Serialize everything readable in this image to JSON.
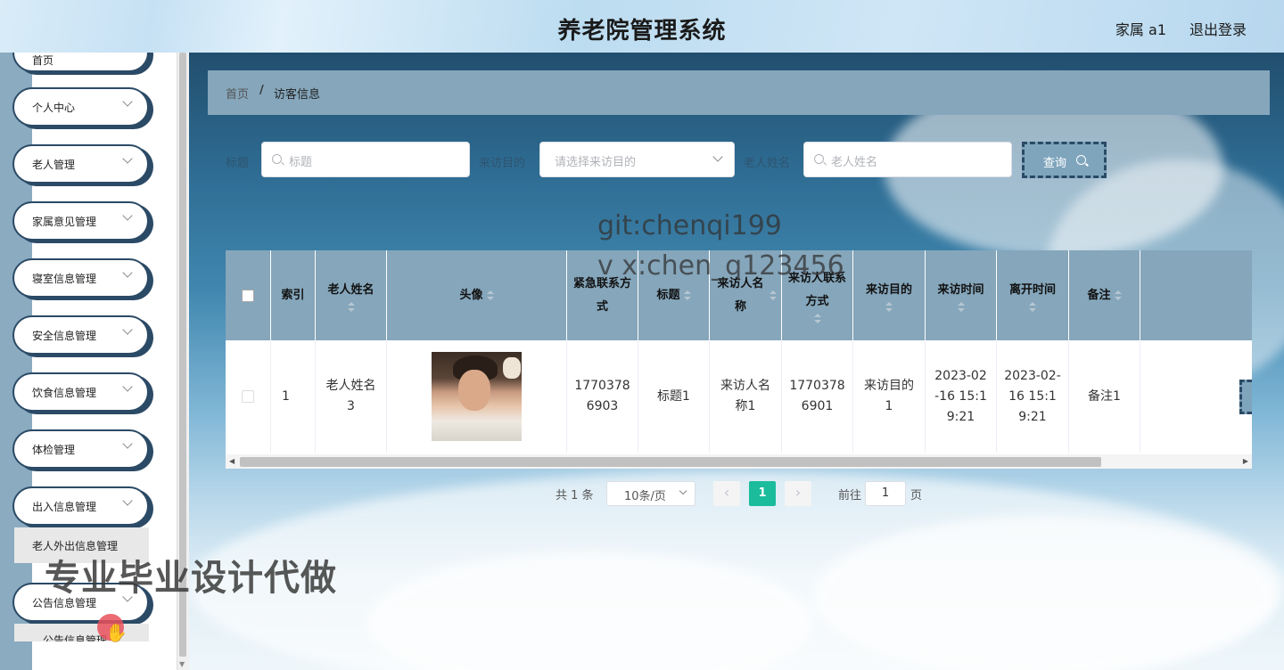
{
  "app": {
    "title": "养老院管理系统",
    "user": "家属 a1",
    "logout": "退出登录"
  },
  "sidebar": {
    "partial_top": "首页",
    "items": [
      "个人中心",
      "老人管理",
      "家属意见管理",
      "寝室信息管理",
      "安全信息管理",
      "饮食信息管理",
      "体检管理",
      "出入信息管理",
      "公告信息管理"
    ],
    "submenu_outgoing": "老人外出信息管理",
    "submenu_notice": "公告信息管理"
  },
  "breadcrumb": {
    "home": "首页",
    "separator": "/",
    "current": "访客信息"
  },
  "filters": {
    "title_label": "标题",
    "title_placeholder": "标题",
    "purpose_label": "来访目的",
    "purpose_placeholder": "请选择来访目的",
    "elder_label": "老人姓名",
    "elder_placeholder": "老人姓名",
    "query_label": "查询"
  },
  "watermarks": {
    "git": "git:chenqi199",
    "vx": "v x:chen_q123456",
    "banner": "专业毕业设计代做"
  },
  "table": {
    "columns": [
      "",
      "索引",
      "老人姓名",
      "头像",
      "紧急联系方式",
      "标题",
      "来访人名称",
      "来访人联系方式",
      "来访目的",
      "来访时间",
      "离开时间",
      "备注",
      ""
    ],
    "rows": [
      {
        "index": "1",
        "elder_name": "老人姓名3",
        "emergency_contact": "17703786903",
        "title": "标题1",
        "visitor_name": "来访人名称1",
        "visitor_contact": "17703786901",
        "purpose": "来访目的1",
        "visit_time": "2023-02-16 15:19:21",
        "leave_time": "2023-02-16 15:19:21",
        "remark": "备注1"
      }
    ]
  },
  "pagination": {
    "total": "共 1 条",
    "page_size": "10条/页",
    "current_page": "1",
    "goto_label": "前往",
    "goto_value": "1",
    "page_suffix": "页"
  },
  "colors": {
    "accent": "#1abc9c",
    "header_bg": "#85a6bb",
    "border_dark": "#2b4a66"
  }
}
